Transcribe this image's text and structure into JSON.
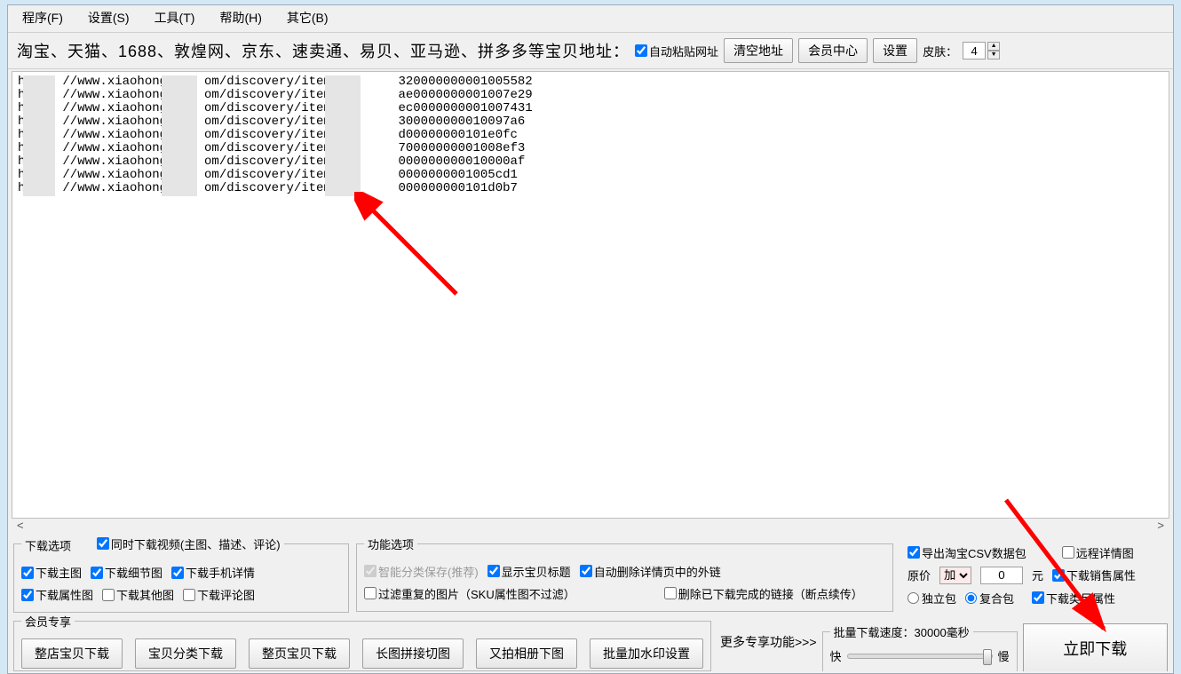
{
  "menu": [
    "程序(F)",
    "设置(S)",
    "工具(T)",
    "帮助(H)",
    "其它(B)"
  ],
  "toolbar": {
    "label": "淘宝、天猫、1688、敦煌网、京东、速卖通、易贝、亚马逊、拼多多等宝贝地址：",
    "auto_paste": "自动粘贴网址",
    "clear": "清空地址",
    "member": "会员中心",
    "settings": "设置",
    "skin_label": "皮肤：",
    "skin_value": "4"
  },
  "urls": [
    "h     //www.xiaohong     om/discovery/item/5       320000000001005582",
    "h     //www.xiaohong     om/discovery/item/5       ae0000000001007e29",
    "h     //www.xiaohong     om/discovery/item/5       ec0000000001007431",
    "h     //www.xiaohong     om/discovery/item/5i      300000000010097a6",
    "h     //www.xiaohong     om/discovery/item/5f      d00000000101e0fc",
    "h     //www.xiaohong     om/discovery/item/5f      70000000001008ef3",
    "h     //www.xiaohong     om/discovery/item/5f      000000000010000af",
    "h     //www.xiaohong     om/discovery/item/5f6     0000000001005cd1",
    "h     //www.xiaohong     om/discovery/item/5f6     000000000101d0b7"
  ],
  "dl": {
    "legend": "下载选项",
    "video": "同时下载视频(主图、描述、评论)",
    "main": "下载主图",
    "detail": "下载细节图",
    "mobile": "下载手机详情",
    "attr": "下载属性图",
    "other": "下载其他图",
    "comment": "下载评论图"
  },
  "fn": {
    "legend": "功能选项",
    "smart": "智能分类保存(推荐)",
    "title": "显示宝贝标题",
    "autodel": "自动删除详情页中的外链",
    "filter": "过滤重复的图片（SKU属性图不过滤）",
    "delete_done": "删除已下载完成的链接（断点续传）"
  },
  "right": {
    "csv": "导出淘宝CSV数据包",
    "remote": "远程详情图",
    "price_prefix": "原价",
    "price_op": "加",
    "price_value": "0",
    "price_unit": "元",
    "sales_attr": "下载销售属性",
    "single": "独立包",
    "combo": "复合包",
    "cat_attr": "下载类目属性"
  },
  "members": {
    "legend": "会员专享",
    "btns": [
      "整店宝贝下载",
      "宝贝分类下载",
      "整页宝贝下载",
      "长图拼接切图",
      "又拍相册下图",
      "批量加水印设置"
    ],
    "more": "更多专享功能>>>"
  },
  "speed": {
    "legend": "批量下载速度：30000毫秒",
    "fast": "快",
    "slow": "慢"
  },
  "download_now": "立即下载"
}
